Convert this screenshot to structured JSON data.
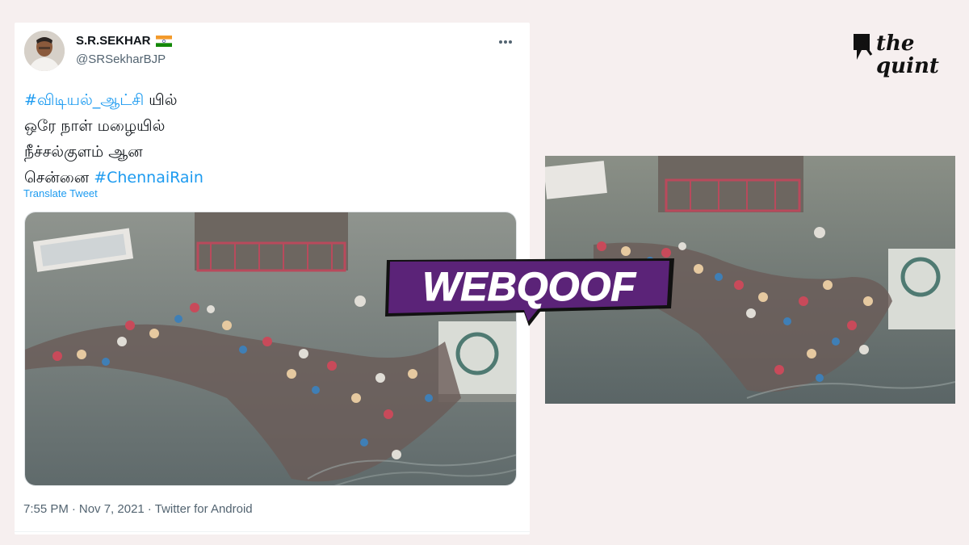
{
  "tweet": {
    "display_name": "S.R.SEKHAR",
    "handle": "@SRSekharBJP",
    "lines": [
      {
        "hashtag": "#விடியல்_ஆட்சி",
        "text": " யில்"
      },
      {
        "hashtag": "",
        "text": "ஒரே நாள் மழையில்"
      },
      {
        "hashtag": "",
        "text": "நீச்சல்குளம் ஆன"
      },
      {
        "hashtag": "#ChennaiRain",
        "text": "சென்னை "
      }
    ],
    "translate_label": "Translate Tweet",
    "time": "7:55 PM",
    "date": "Nov 7, 2021",
    "source": "Twitter for Android",
    "meta_separator": "·"
  },
  "badge": {
    "label": "WEBQOOF",
    "color": "#5b2378"
  },
  "logo": {
    "line1": "the",
    "line2": "quint"
  },
  "icons": {
    "more": "more-horizontal-icon",
    "flag": "india-flag-icon"
  },
  "colors": {
    "link": "#1d9bf0",
    "background": "#f6efef",
    "badge_purple": "#5b2378"
  }
}
